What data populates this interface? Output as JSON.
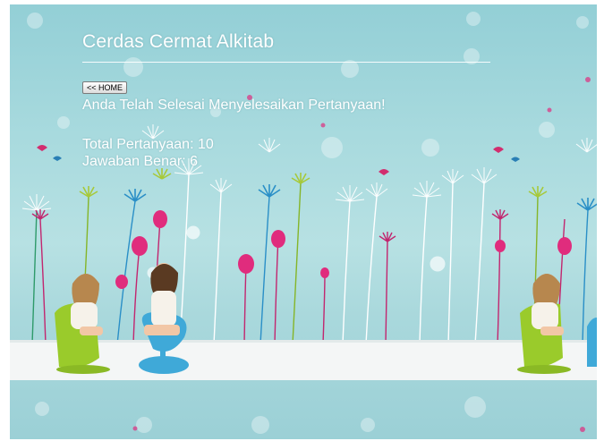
{
  "page": {
    "title": "Cerdas Cermat Alkitab",
    "home_button_label": "<< HOME",
    "message": "Anda Telah Selesai Menyelesaikan Pertanyaan!",
    "total_questions_text": "Total Pertanyaan: 10",
    "correct_answers_text": "Jawaban Benar: 6"
  },
  "colors": {
    "background": "#a8dade",
    "text": "#ffffff",
    "floor": "#f4f6f6",
    "flower_pink": "#e02c7d",
    "flower_white": "#ffffff",
    "flower_lime": "#a7c93a",
    "flower_blue": "#2a8fc7",
    "chair_lime": "#9acb2b",
    "chair_blue": "#3fa9d8"
  }
}
